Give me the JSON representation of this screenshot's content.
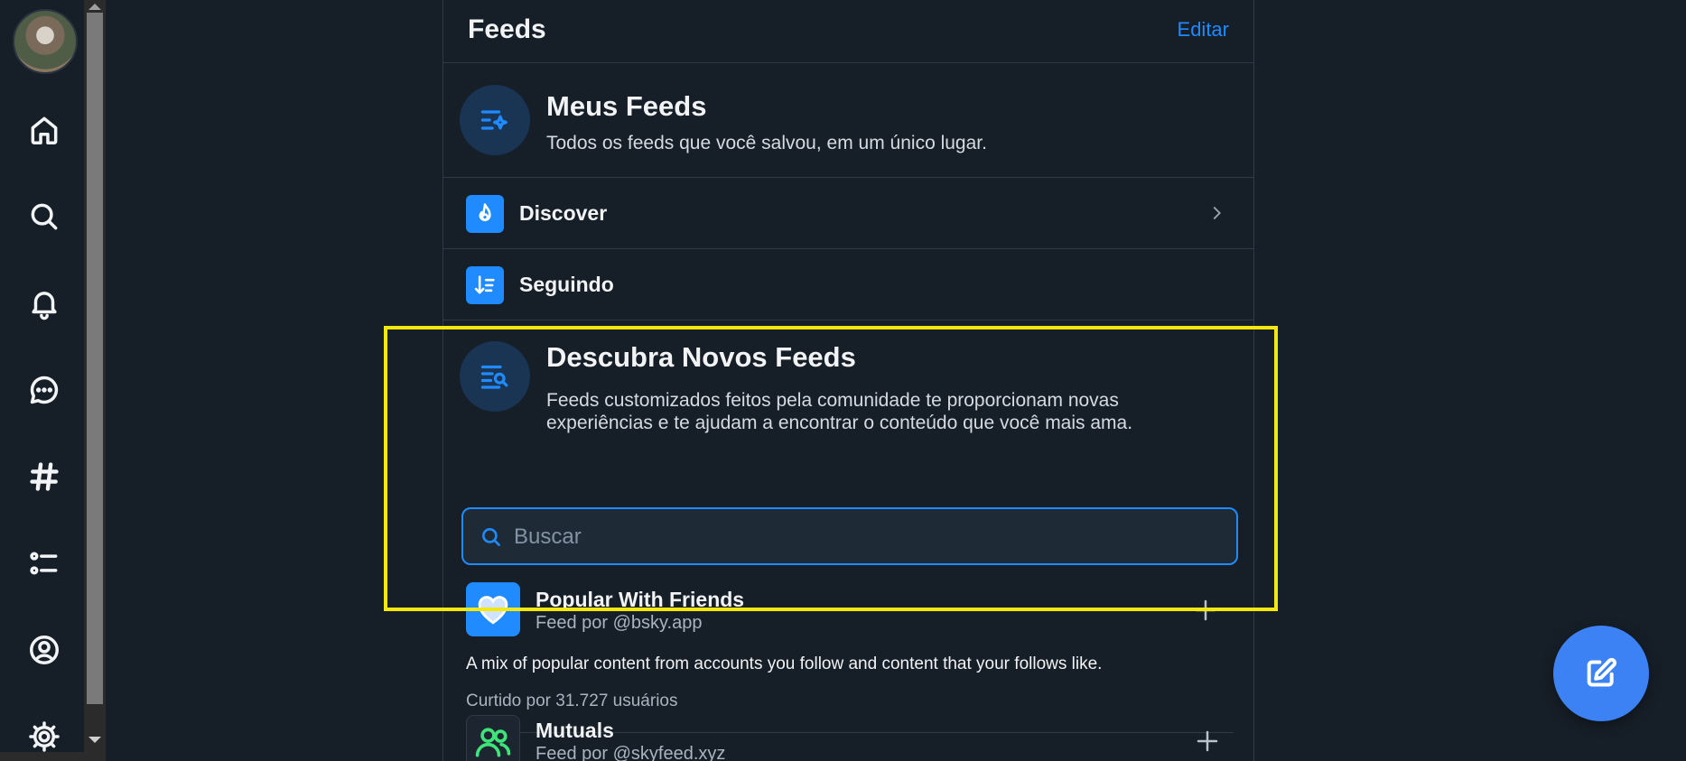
{
  "nav": {
    "items": [
      {
        "name": "home",
        "label": "Home"
      },
      {
        "name": "search",
        "label": "Search"
      },
      {
        "name": "notifications",
        "label": "Notifications"
      },
      {
        "name": "chat",
        "label": "Chat"
      },
      {
        "name": "feeds",
        "label": "Feeds"
      },
      {
        "name": "lists",
        "label": "Lists"
      },
      {
        "name": "profile",
        "label": "Profile"
      },
      {
        "name": "settings",
        "label": "Settings"
      }
    ]
  },
  "header": {
    "title": "Feeds",
    "edit_label": "Editar"
  },
  "my_feeds": {
    "title": "Meus Feeds",
    "description": "Todos os feeds que você salvou, em um único lugar."
  },
  "pinned": [
    {
      "label": "Discover",
      "icon": "flame-icon"
    },
    {
      "label": "Seguindo",
      "icon": "sort-list-icon"
    }
  ],
  "discover": {
    "title": "Descubra Novos Feeds",
    "description_line1": "Feeds customizados feitos pela comunidade te proporcionam novas",
    "description_line2": "experiências e te ajudam a encontrar o conteúdo que você mais ama.",
    "search_placeholder": "Buscar"
  },
  "feeds": [
    {
      "name": "Popular With Friends",
      "by": "Feed por @bsky.app",
      "description": "A mix of popular content from accounts you follow and content that your follows like.",
      "likes": "Curtido por 31.727 usuários"
    },
    {
      "name": "Mutuals",
      "by": "Feed por @skyfeed.xyz"
    }
  ],
  "colors": {
    "accent": "#208bfe",
    "background": "#161e27",
    "highlight": "#f5e80e",
    "fab": "#3d82f4"
  }
}
